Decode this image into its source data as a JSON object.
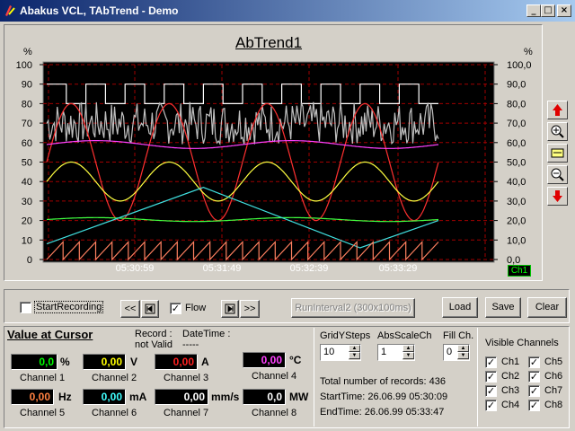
{
  "window": {
    "title": "Abakus VCL, TAbTrend - Demo",
    "min": "_",
    "max": "□",
    "close": "×"
  },
  "chart": {
    "title": "AbTrend1",
    "unit_left": "%",
    "unit_right": "%",
    "channel_badge": "Ch1"
  },
  "chart_data": {
    "type": "line",
    "title": "AbTrend1",
    "ylabel": "%",
    "ylim": [
      0,
      100
    ],
    "y_ticks_left": [
      "100",
      "90",
      "80",
      "70",
      "60",
      "50",
      "40",
      "30",
      "20",
      "10",
      "0"
    ],
    "y_ticks_right": [
      "100,0",
      "90,0",
      "80,0",
      "70,0",
      "60,0",
      "50,0",
      "40,0",
      "30,0",
      "20,0",
      "10,0",
      "0,0"
    ],
    "x_ticks": [
      "05:30:59",
      "05:31:49",
      "05:32:39",
      "05:33:29"
    ],
    "grid": true,
    "series": [
      {
        "color": "#ffffff",
        "kind": "square",
        "low": 80,
        "high": 90,
        "cycles": 10
      },
      {
        "color": "#c0c0c0",
        "kind": "noise",
        "center": 70,
        "amplitude": 11
      },
      {
        "color": "#ff3030",
        "kind": "sine",
        "center": 50,
        "amplitude": 30,
        "cycles": 4
      },
      {
        "color": "#ff40ff",
        "kind": "sine",
        "center": 59,
        "amplitude": 2,
        "cycles": 2
      },
      {
        "color": "#ffff40",
        "kind": "sine",
        "center": 40,
        "amplitude": 10,
        "cycles": 4
      },
      {
        "color": "#40ff40",
        "kind": "sine",
        "center": 20.5,
        "amplitude": 1,
        "cycles": 2
      },
      {
        "color": "#40e0e0",
        "kind": "triangle",
        "points": [
          [
            0,
            8
          ],
          [
            0.4,
            37
          ],
          [
            0.8,
            6
          ],
          [
            1,
            20
          ]
        ]
      },
      {
        "color": "#ff8060",
        "kind": "sawtooth",
        "low": 0,
        "high": 9,
        "cycles": 24
      }
    ]
  },
  "toolbar": {
    "start_recording": "StartRecording",
    "rewind": "<<",
    "flow": "Flow",
    "forward": ">>",
    "run_interval": "RunInterval2 (300x100ms)",
    "load": "Load",
    "save": "Save",
    "clear": "Clear"
  },
  "cursor": {
    "title": "Value at Cursor",
    "record_label": "Record :",
    "record_value": "not Valid",
    "datetime_label": "DateTime :",
    "datetime_value": "-----"
  },
  "channels": [
    {
      "label": "Channel 1",
      "value": "0,0",
      "unit": "%",
      "color": "#00ff00"
    },
    {
      "label": "Channel 2",
      "value": "0,00",
      "unit": "V",
      "color": "#ffff00"
    },
    {
      "label": "Channel 3",
      "value": "0,00",
      "unit": "A",
      "color": "#ff2020"
    },
    {
      "label": "Channel 4",
      "value": "0,00",
      "unit": "°C",
      "color": "#ff40ff"
    },
    {
      "label": "Channel 5",
      "value": "0,00",
      "unit": "Hz",
      "color": "#ff8040"
    },
    {
      "label": "Channel 6",
      "value": "0,00",
      "unit": "mA",
      "color": "#40ffff"
    },
    {
      "label": "Channel 7",
      "value": "0,00",
      "unit": "mm/s",
      "color": "#ffffff"
    },
    {
      "label": "Channel 8",
      "value": "0,0",
      "unit": "MW",
      "color": "#ffffff"
    }
  ],
  "settings": {
    "grid_label": "GridYSteps",
    "grid_value": "10",
    "abs_label": "AbsScaleCh",
    "abs_value": "1",
    "fill_label": "Fill Ch.",
    "fill_value": "0"
  },
  "stats": {
    "total": "Total number of records:  436",
    "start": "StartTime: 26.06.99 05:30:09",
    "end": "EndTime: 26.06.99 05:33:47"
  },
  "visible": {
    "title": "Visible Channels",
    "items": [
      "Ch1",
      "Ch2",
      "Ch3",
      "Ch4",
      "Ch5",
      "Ch6",
      "Ch7",
      "Ch8"
    ]
  }
}
